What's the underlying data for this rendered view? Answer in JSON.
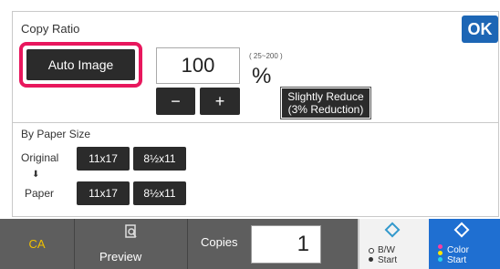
{
  "header": {
    "title": "Copy Ratio",
    "ok_label": "OK"
  },
  "auto_image": {
    "label": "Auto Image"
  },
  "ratio": {
    "value": "100",
    "range": "( 25~200 )",
    "unit": "%"
  },
  "stepper": {
    "minus": "−",
    "plus": "+"
  },
  "slightly_reduce": {
    "line1": "Slightly Reduce",
    "line2": "(3% Reduction)"
  },
  "paper_size": {
    "heading": "By Paper Size",
    "original_label": "Original",
    "paper_label": "Paper",
    "arrow": "⬇",
    "original_options": [
      "11x17",
      "8½x11"
    ],
    "paper_options": [
      "11x17",
      "8½x11"
    ]
  },
  "footer": {
    "ca": "CA",
    "preview": "Preview",
    "copies_label": "Copies",
    "copies_value": "1",
    "bw_start": [
      "B/W",
      "Start"
    ],
    "color_start": [
      "Color",
      "Start"
    ]
  },
  "colors": {
    "accent": "#1d66b5",
    "highlight": "#e8175d",
    "ca_text": "#f0c000",
    "color_start_bg": "#1f6fd1"
  }
}
